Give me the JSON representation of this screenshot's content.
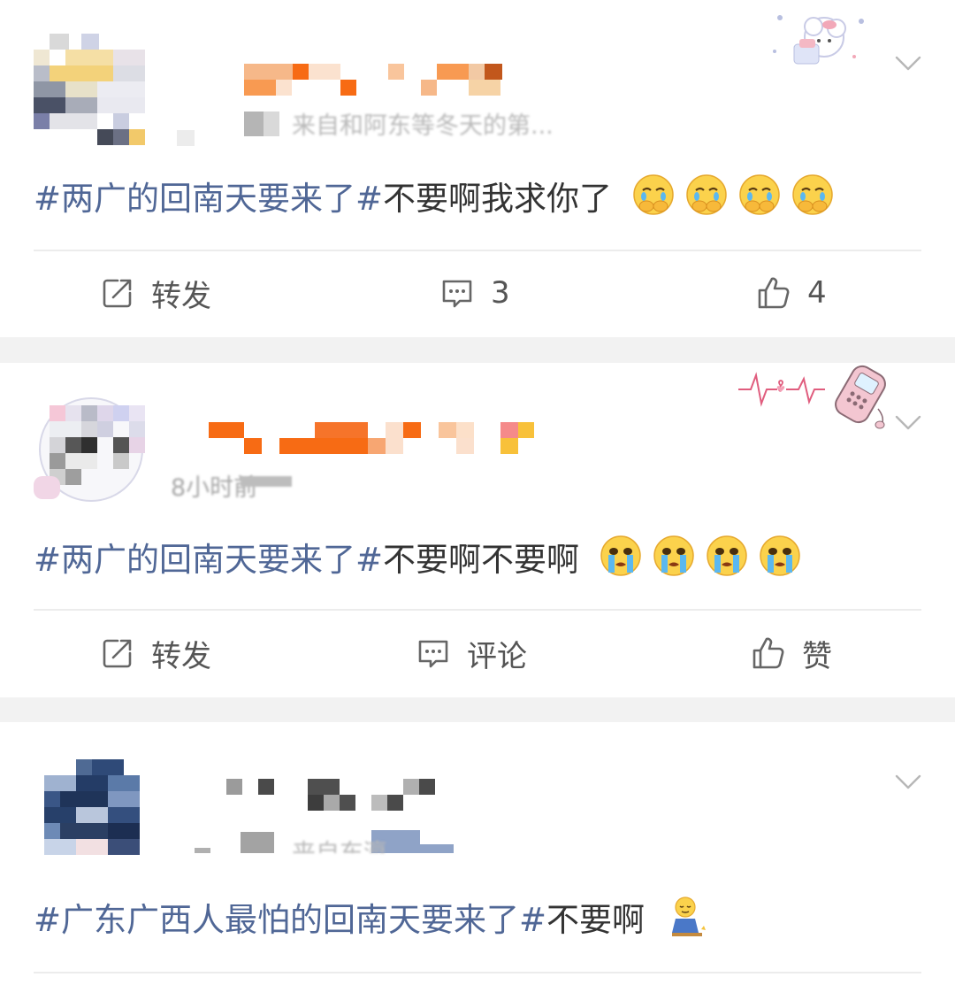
{
  "posts": [
    {
      "subline": "来自和阿东等冬天的第...",
      "topic": "#两广的回南天要来了#",
      "body": "不要啊我求你了",
      "emoji": [
        "crying-cover-face",
        "crying-cover-face",
        "crying-cover-face",
        "crying-cover-face"
      ],
      "actions": {
        "repost": "转发",
        "comment": "3",
        "like": "4"
      }
    },
    {
      "subline": "8小时前",
      "topic": "#两广的回南天要来了#",
      "body": "不要啊不要啊",
      "emoji": [
        "crying-face",
        "crying-face",
        "crying-face",
        "crying-face"
      ],
      "actions": {
        "repost": "转发",
        "comment": "评论",
        "like": "赞"
      }
    },
    {
      "subline": "来自东瀛",
      "topic": "#广东广西人最怕的回南天要来了#",
      "body": "不要啊",
      "emoji": [
        "kneeling-figure"
      ],
      "actions": {}
    }
  ],
  "icons": {
    "repost": "repost-icon",
    "comment": "comment-icon",
    "like": "thumbs-up-icon",
    "menu": "chevron-down-icon"
  },
  "colors": {
    "topic": "#506796",
    "text": "#333333",
    "action_text": "#555555",
    "separator": "#f2f2f2",
    "name_orange": "#f76b14"
  }
}
